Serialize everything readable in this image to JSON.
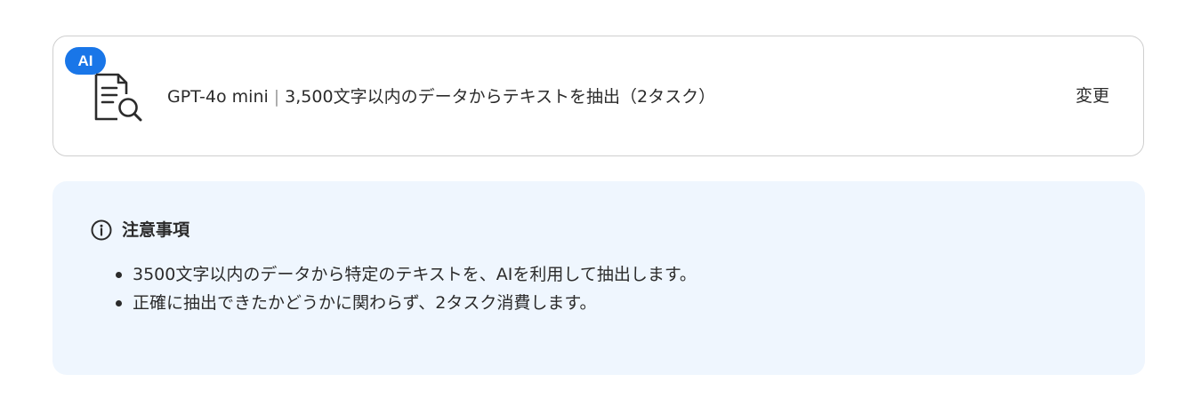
{
  "model_card": {
    "badge": "AI",
    "icon": "document-search-icon",
    "model_name": "GPT-4o mini",
    "separator": "|",
    "description": "3,500文字以内のデータからテキストを抽出（2タスク）",
    "change_label": "変更",
    "badge_color": "#1976e8"
  },
  "notice": {
    "icon": "info-icon",
    "title": "注意事項",
    "items": [
      "3500文字以内のデータから特定のテキストを、AIを利用して抽出します。",
      "正確に抽出できたかどうかに関わらず、2タスク消費します。"
    ],
    "background_color": "#eff6fe"
  }
}
